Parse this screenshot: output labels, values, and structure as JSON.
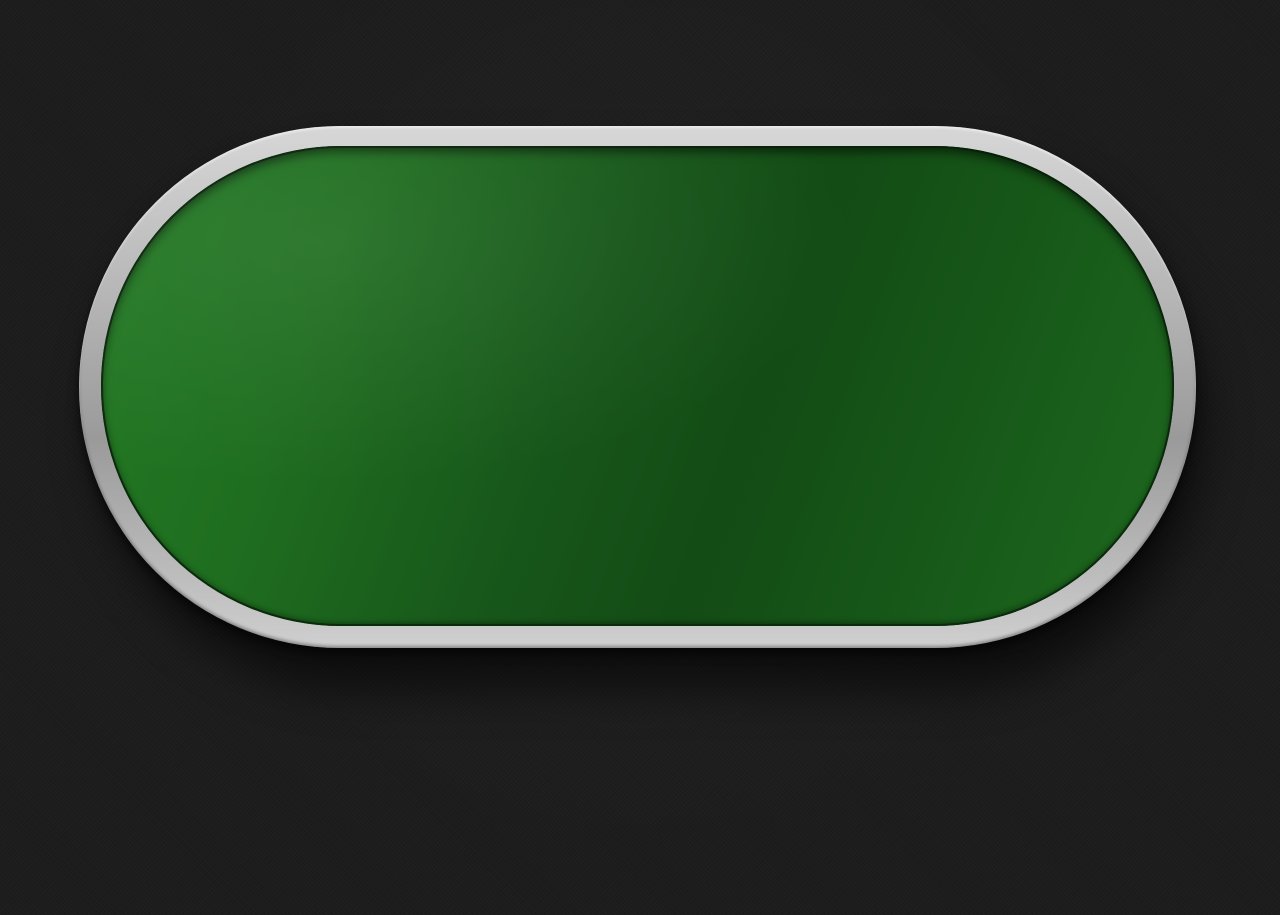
{
  "scene": {
    "background_color": "#1c1c1c",
    "table": {
      "shape": "oval",
      "rail_color": "#b5b5b5",
      "felt_color": "#17561a",
      "felt_highlight_color": "#237a24"
    }
  }
}
